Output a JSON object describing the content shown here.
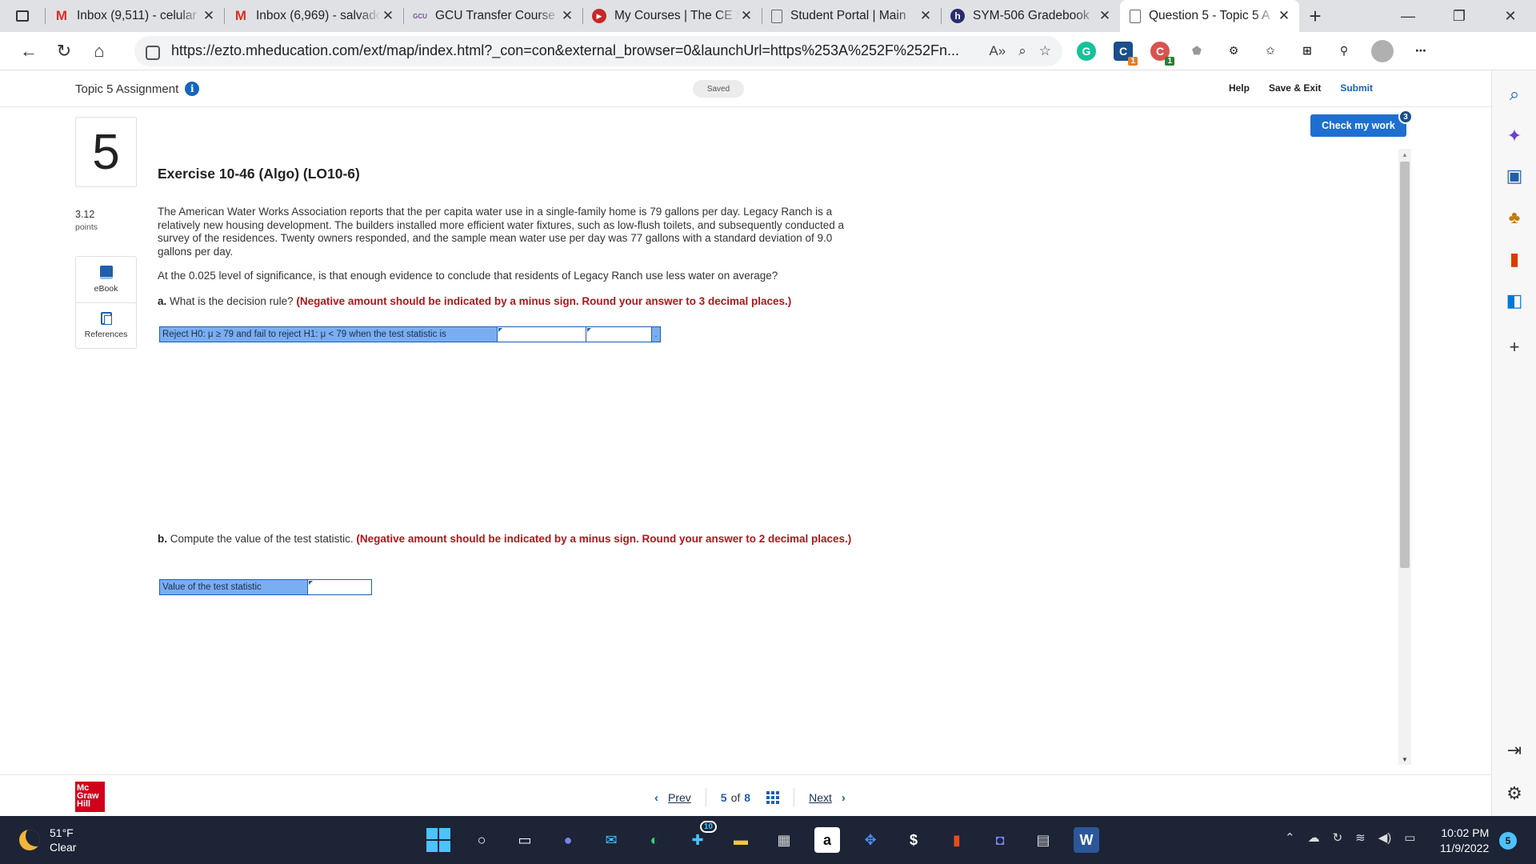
{
  "browser": {
    "tabs": [
      {
        "title": "Inbox (9,511) - celular",
        "icon": "gmail-icon",
        "active": false
      },
      {
        "title": "Inbox (6,969) - salvador",
        "icon": "gmail-icon",
        "active": false
      },
      {
        "title": "GCU Transfer Course S",
        "icon": "gcu-icon",
        "active": false
      },
      {
        "title": "My Courses | The CE S",
        "icon": "play-icon",
        "active": false
      },
      {
        "title": "Student Portal | Main",
        "icon": "document-icon",
        "active": false
      },
      {
        "title": "SYM-506 Gradebook",
        "icon": "h-icon",
        "active": false
      },
      {
        "title": "Question 5 - Topic 5 A",
        "icon": "document-icon",
        "active": true
      }
    ],
    "url": "https://ezto.mheducation.com/ext/map/index.html?_con=con&external_browser=0&launchUrl=https%253A%252F%252Fn...",
    "extension_badges": {
      "chem": "1",
      "red": "1"
    }
  },
  "header": {
    "topic_title": "Topic 5 Assignment",
    "saved_label": "Saved",
    "help": "Help",
    "save_exit": "Save & Exit",
    "submit": "Submit",
    "check_work": "Check my work",
    "check_badge": "3"
  },
  "question": {
    "number": "5",
    "points_value": "3.12",
    "points_label": "points",
    "resources": {
      "ebook": "eBook",
      "references": "References"
    },
    "title": "Exercise 10-46 (Algo) (LO10-6)",
    "problem": "The American Water Works Association reports that the per capita water use in a single-family home is 79 gallons per day. Legacy Ranch is a relatively new housing development. The builders installed more efficient water fixtures, such as low-flush toilets, and subsequently conducted a survey of the residences. Twenty owners responded, and the sample mean water use per day was 77 gallons with a standard deviation of 9.0 gallons per day.",
    "prompt": "At the 0.025 level of significance, is that enough evidence to conclude that residents of Legacy Ranch use less water on average?",
    "part_a": {
      "label": "a.",
      "text": "What is the decision rule?",
      "hint": "(Negative amount should be indicated by a minus sign. Round your answer to 3 decimal places.)",
      "row_label": "Reject H0: μ ≥ 79 and fail to reject H1: μ < 79 when the test statistic is",
      "end_char": "."
    },
    "part_b": {
      "label": "b.",
      "text": "Compute the value of the test statistic.",
      "hint": "(Negative amount should be indicated by a minus sign. Round your answer to 2 decimal places.)",
      "row_label": "Value of the test statistic"
    }
  },
  "footer": {
    "logo_lines": [
      "Mc",
      "Graw",
      "Hill"
    ],
    "prev": "Prev",
    "current": "5",
    "of": "of",
    "total": "8",
    "next": "Next"
  },
  "taskbar": {
    "temperature": "51°F",
    "condition": "Clear",
    "time": "10:02 PM",
    "date": "11/9/2022",
    "notification_count": "5",
    "app_badge": "10"
  }
}
